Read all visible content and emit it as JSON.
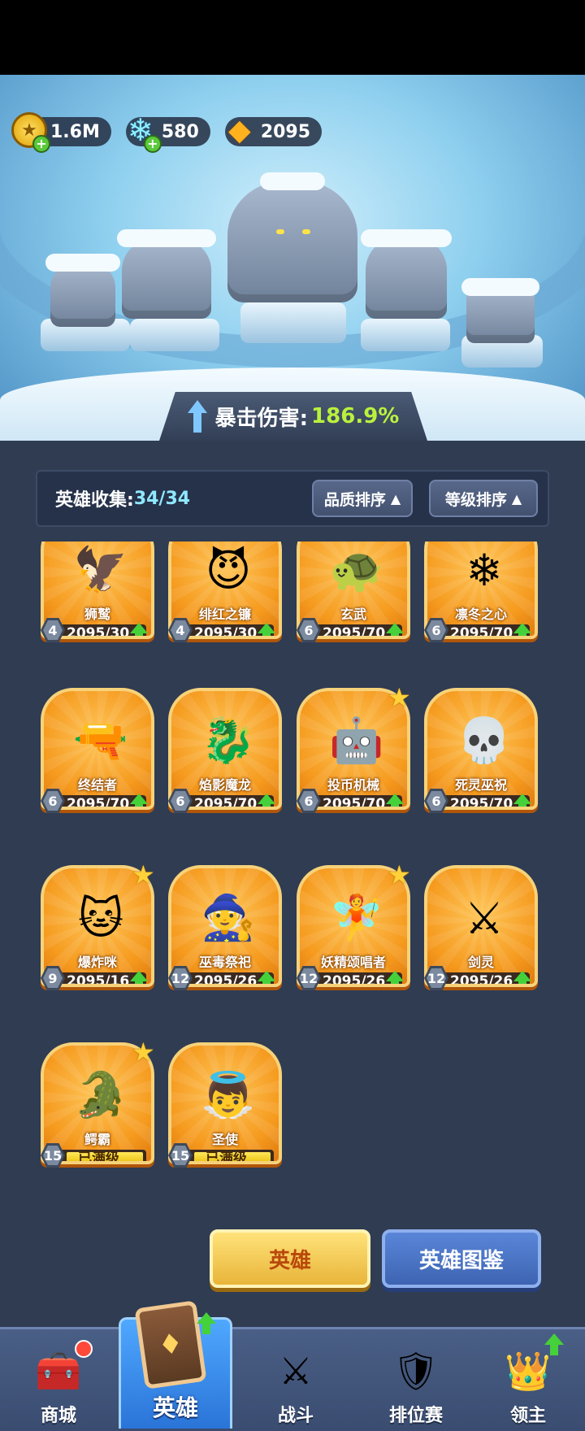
{
  "currencies": [
    {
      "icon": "gold-coin-icon",
      "value": "1.6M"
    },
    {
      "icon": "blue-crystal-icon",
      "value": "580"
    },
    {
      "icon": "amber-crystal-icon",
      "value": "2095"
    }
  ],
  "crit": {
    "label": "暴击伤害:",
    "value": "186.9%"
  },
  "collection": {
    "label": "英雄收集:",
    "count": "34/34"
  },
  "sort": {
    "quality": "品质排序",
    "level": "等级排序"
  },
  "heroes": [
    {
      "name": "狮鹫",
      "level": "4",
      "progress": "2095/30",
      "star": false,
      "maxed": false,
      "icon": "griffin-icon",
      "glyph": "🦅"
    },
    {
      "name": "绯红之镰",
      "level": "4",
      "progress": "2095/30",
      "star": false,
      "maxed": false,
      "icon": "scythe-demon-icon",
      "glyph": "😈"
    },
    {
      "name": "玄武",
      "level": "6",
      "progress": "2095/70",
      "star": false,
      "maxed": false,
      "icon": "turtle-icon",
      "glyph": "🐢"
    },
    {
      "name": "凛冬之心",
      "level": "6",
      "progress": "2095/70",
      "star": false,
      "maxed": false,
      "icon": "ice-queen-icon",
      "glyph": "❄"
    },
    {
      "name": "终结者",
      "level": "6",
      "progress": "2095/70",
      "star": false,
      "maxed": false,
      "icon": "terminator-icon",
      "glyph": "🔫"
    },
    {
      "name": "焰影魔龙",
      "level": "6",
      "progress": "2095/70",
      "star": false,
      "maxed": false,
      "icon": "dragon-icon",
      "glyph": "🐉"
    },
    {
      "name": "投币机械",
      "level": "6",
      "progress": "2095/70",
      "star": true,
      "maxed": false,
      "icon": "robot-icon",
      "glyph": "🤖"
    },
    {
      "name": "死灵巫祝",
      "level": "6",
      "progress": "2095/70",
      "star": false,
      "maxed": false,
      "icon": "necromancer-icon",
      "glyph": "💀"
    },
    {
      "name": "爆炸咪",
      "level": "9",
      "progress": "2095/16",
      "star": true,
      "maxed": false,
      "icon": "cat-girl-icon",
      "glyph": "🐱"
    },
    {
      "name": "巫毒祭祀",
      "level": "12",
      "progress": "2095/26",
      "star": false,
      "maxed": false,
      "icon": "voodoo-icon",
      "glyph": "🧙"
    },
    {
      "name": "妖精颂唱者",
      "level": "12",
      "progress": "2095/26",
      "star": true,
      "maxed": false,
      "icon": "fairy-icon",
      "glyph": "🧚"
    },
    {
      "name": "剑灵",
      "level": "12",
      "progress": "2095/26",
      "star": false,
      "maxed": false,
      "icon": "sword-spirit-icon",
      "glyph": "⚔"
    },
    {
      "name": "鳄霸",
      "level": "15",
      "progress": "已满级",
      "star": true,
      "maxed": true,
      "icon": "crocodile-icon",
      "glyph": "🐊"
    },
    {
      "name": "圣使",
      "level": "15",
      "progress": "已满级",
      "star": false,
      "maxed": true,
      "icon": "angel-icon",
      "glyph": "👼"
    }
  ],
  "actions": {
    "hero": "英雄",
    "atlas": "英雄图鉴"
  },
  "nav": {
    "shop": "商城",
    "hero": "英雄",
    "battle": "战斗",
    "ranked": "排位赛",
    "lord": "领主"
  },
  "colors": {
    "accent_green": "#b9f23c",
    "card_orange": "#f59a1e",
    "nav_active": "#2a74d8"
  }
}
